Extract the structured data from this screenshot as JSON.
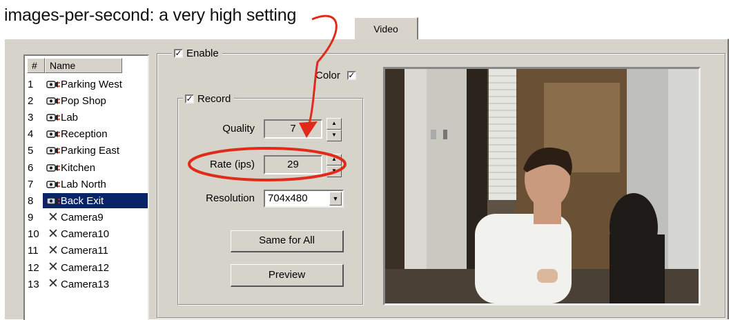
{
  "annotation": {
    "text": "images-per-second: a very high setting"
  },
  "tab": {
    "label": "Video"
  },
  "camera_list": {
    "headers": {
      "num": "#",
      "name": "Name"
    },
    "cameras": [
      {
        "num": "1",
        "name": "Parking West",
        "icon": "camera-icon"
      },
      {
        "num": "2",
        "name": "Pop Shop",
        "icon": "camera-icon"
      },
      {
        "num": "3",
        "name": "Lab",
        "icon": "camera-icon"
      },
      {
        "num": "4",
        "name": "Reception",
        "icon": "camera-icon"
      },
      {
        "num": "5",
        "name": "Parking East",
        "icon": "camera-icon"
      },
      {
        "num": "6",
        "name": "Kitchen",
        "icon": "camera-icon"
      },
      {
        "num": "7",
        "name": "Lab North",
        "icon": "camera-icon"
      },
      {
        "num": "8",
        "name": "Back Exit",
        "icon": "camera-icon",
        "selected": true
      },
      {
        "num": "9",
        "name": "Camera9",
        "icon": "disabled-x-icon"
      },
      {
        "num": "10",
        "name": "Camera10",
        "icon": "disabled-x-icon"
      },
      {
        "num": "11",
        "name": "Camera11",
        "icon": "disabled-x-icon"
      },
      {
        "num": "12",
        "name": "Camera12",
        "icon": "disabled-x-icon"
      },
      {
        "num": "13",
        "name": "Camera13",
        "icon": "disabled-x-icon"
      }
    ]
  },
  "enable": {
    "label": "Enable",
    "checked": true
  },
  "color": {
    "label": "Color",
    "checked": true
  },
  "record": {
    "label": "Record",
    "checked": true,
    "quality": {
      "label": "Quality",
      "value": "7"
    },
    "rate": {
      "label": "Rate (ips)",
      "value": "29"
    },
    "resolution": {
      "label": "Resolution",
      "value": "704x480"
    },
    "same_for_all_label": "Same for All",
    "preview_label": "Preview"
  },
  "colors": {
    "selection": "#0a246a",
    "annotation_red": "#e02a1a",
    "panel_bg": "#d6d3ca"
  }
}
